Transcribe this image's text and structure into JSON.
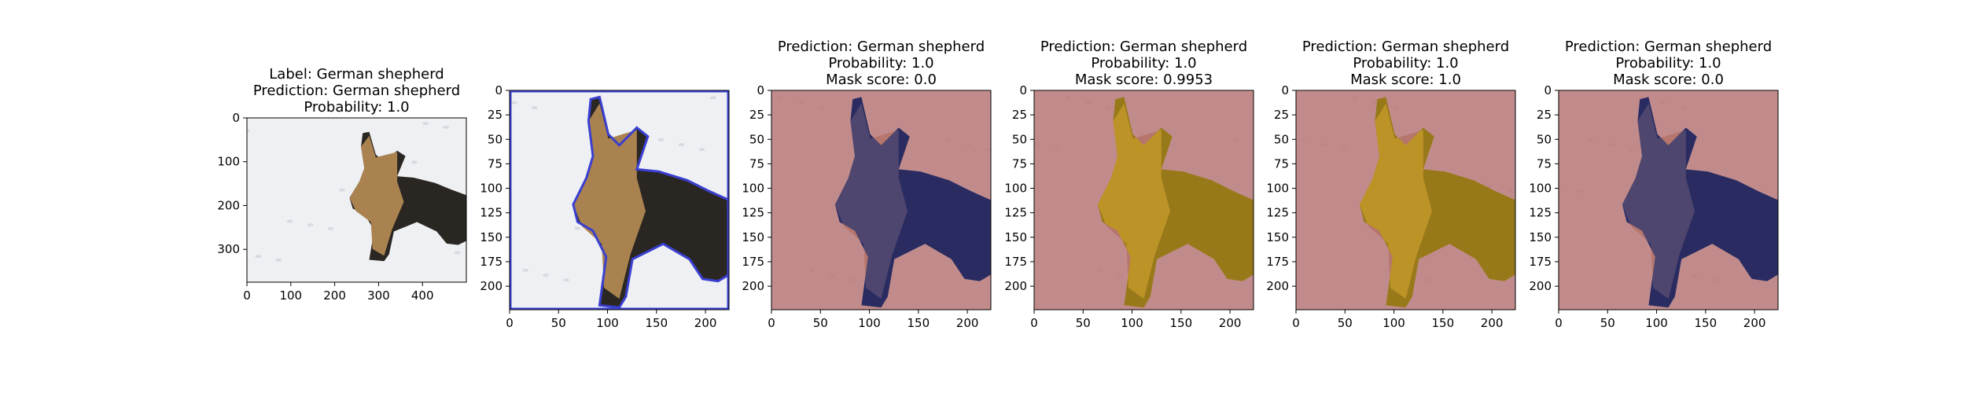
{
  "colors": {
    "snow_bg": "#eef0f3",
    "dog_dark": "#2a2622",
    "dog_tan": "#a9824f",
    "overlay_red": "#b87474",
    "overlay_blue": "#2b2f7a",
    "overlay_yellow": "#c39a17",
    "contour_blue": "#3a3fd0"
  },
  "chart_data": [
    {
      "type": "image",
      "title_lines": [
        "Label: German shepherd",
        "Prediction: German shepherd",
        "Probability: 1.0"
      ],
      "xlim": [
        0,
        500
      ],
      "ylim": [
        375,
        0
      ],
      "xticks": [
        0,
        100,
        200,
        300,
        400
      ],
      "yticks": [
        0,
        100,
        200,
        300
      ],
      "style": "photo"
    },
    {
      "type": "image",
      "title_lines": [],
      "xlim": [
        0,
        224
      ],
      "ylim": [
        224,
        0
      ],
      "xticks": [
        0,
        50,
        100,
        150,
        200
      ],
      "yticks": [
        0,
        25,
        50,
        75,
        100,
        125,
        150,
        175,
        200
      ],
      "style": "contour"
    },
    {
      "type": "image",
      "title_lines": [
        "Prediction: German shepherd",
        "Probability: 1.0",
        "Mask score: 0.0"
      ],
      "xlim": [
        0,
        224
      ],
      "ylim": [
        224,
        0
      ],
      "xticks": [
        0,
        50,
        100,
        150,
        200
      ],
      "yticks": [
        0,
        25,
        50,
        75,
        100,
        125,
        150,
        175,
        200
      ],
      "style": "overlay_blue"
    },
    {
      "type": "image",
      "title_lines": [
        "Prediction: German shepherd",
        "Probability: 1.0",
        "Mask score: 0.9953"
      ],
      "xlim": [
        0,
        224
      ],
      "ylim": [
        224,
        0
      ],
      "xticks": [
        0,
        50,
        100,
        150,
        200
      ],
      "yticks": [
        0,
        25,
        50,
        75,
        100,
        125,
        150,
        175,
        200
      ],
      "style": "overlay_yellow"
    },
    {
      "type": "image",
      "title_lines": [
        "Prediction: German shepherd",
        "Probability: 1.0",
        "Mask score: 1.0"
      ],
      "xlim": [
        0,
        224
      ],
      "ylim": [
        224,
        0
      ],
      "xticks": [
        0,
        50,
        100,
        150,
        200
      ],
      "yticks": [
        0,
        25,
        50,
        75,
        100,
        125,
        150,
        175,
        200
      ],
      "style": "overlay_yellow"
    },
    {
      "type": "image",
      "title_lines": [
        "Prediction: German shepherd",
        "Probability: 1.0",
        "Mask score: 0.0"
      ],
      "xlim": [
        0,
        224
      ],
      "ylim": [
        224,
        0
      ],
      "xticks": [
        0,
        50,
        100,
        150,
        200
      ],
      "yticks": [
        0,
        25,
        50,
        75,
        100,
        125,
        150,
        175,
        200
      ],
      "style": "overlay_blue"
    }
  ]
}
